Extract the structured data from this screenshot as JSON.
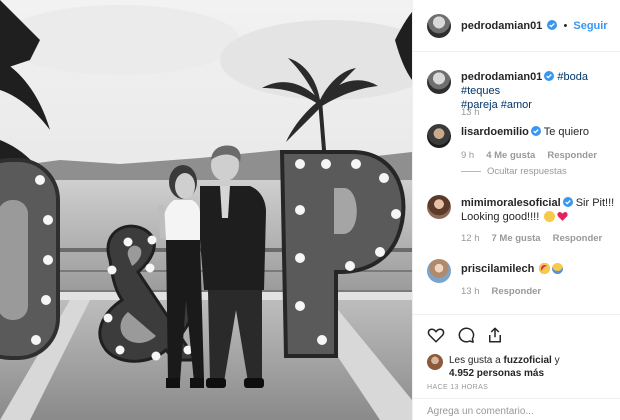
{
  "post": {
    "username": "pedrodamian01",
    "follow_dot": "•",
    "follow_label": "Seguir",
    "caption_user": "pedrodamian01",
    "caption_tags_line1": "#boda #teques",
    "caption_tags_line2": "#pareja #amor",
    "caption_age": "13 h",
    "likes_prefix": "Les gusta a",
    "likes_user": "fuzzoficial",
    "likes_connector": "y",
    "likes_count": "4.952 personas más",
    "posted_ago": "HACE 13 HORAS",
    "add_comment_placeholder": "Agrega un comentario..."
  },
  "comments": [
    {
      "user": "lisardoemilio",
      "text": "Te quiero",
      "age": "9 h",
      "likes": "4 Me gusta",
      "reply": "Responder",
      "hide_replies": "Ocultar respuestas"
    },
    {
      "user": "mimimoralesoficial",
      "text_line1": "Sir Pit!!!",
      "text_line2": "Looking good!!!!",
      "age": "12 h",
      "likes": "7 Me gusta",
      "reply": "Responder"
    },
    {
      "user": "priscilamilech",
      "age": "13 h",
      "reply": "Responder"
    }
  ],
  "icons": [
    "verified-badge-icon",
    "heart-icon",
    "comment-icon",
    "share-icon",
    "winking-face-icon",
    "red-heart-icon",
    "heart-eyes-icon",
    "screaming-face-icon"
  ],
  "colors": {
    "link": "#3897f0",
    "hashtag": "#003569",
    "verified": "#3897f0",
    "muted": "#999999"
  }
}
